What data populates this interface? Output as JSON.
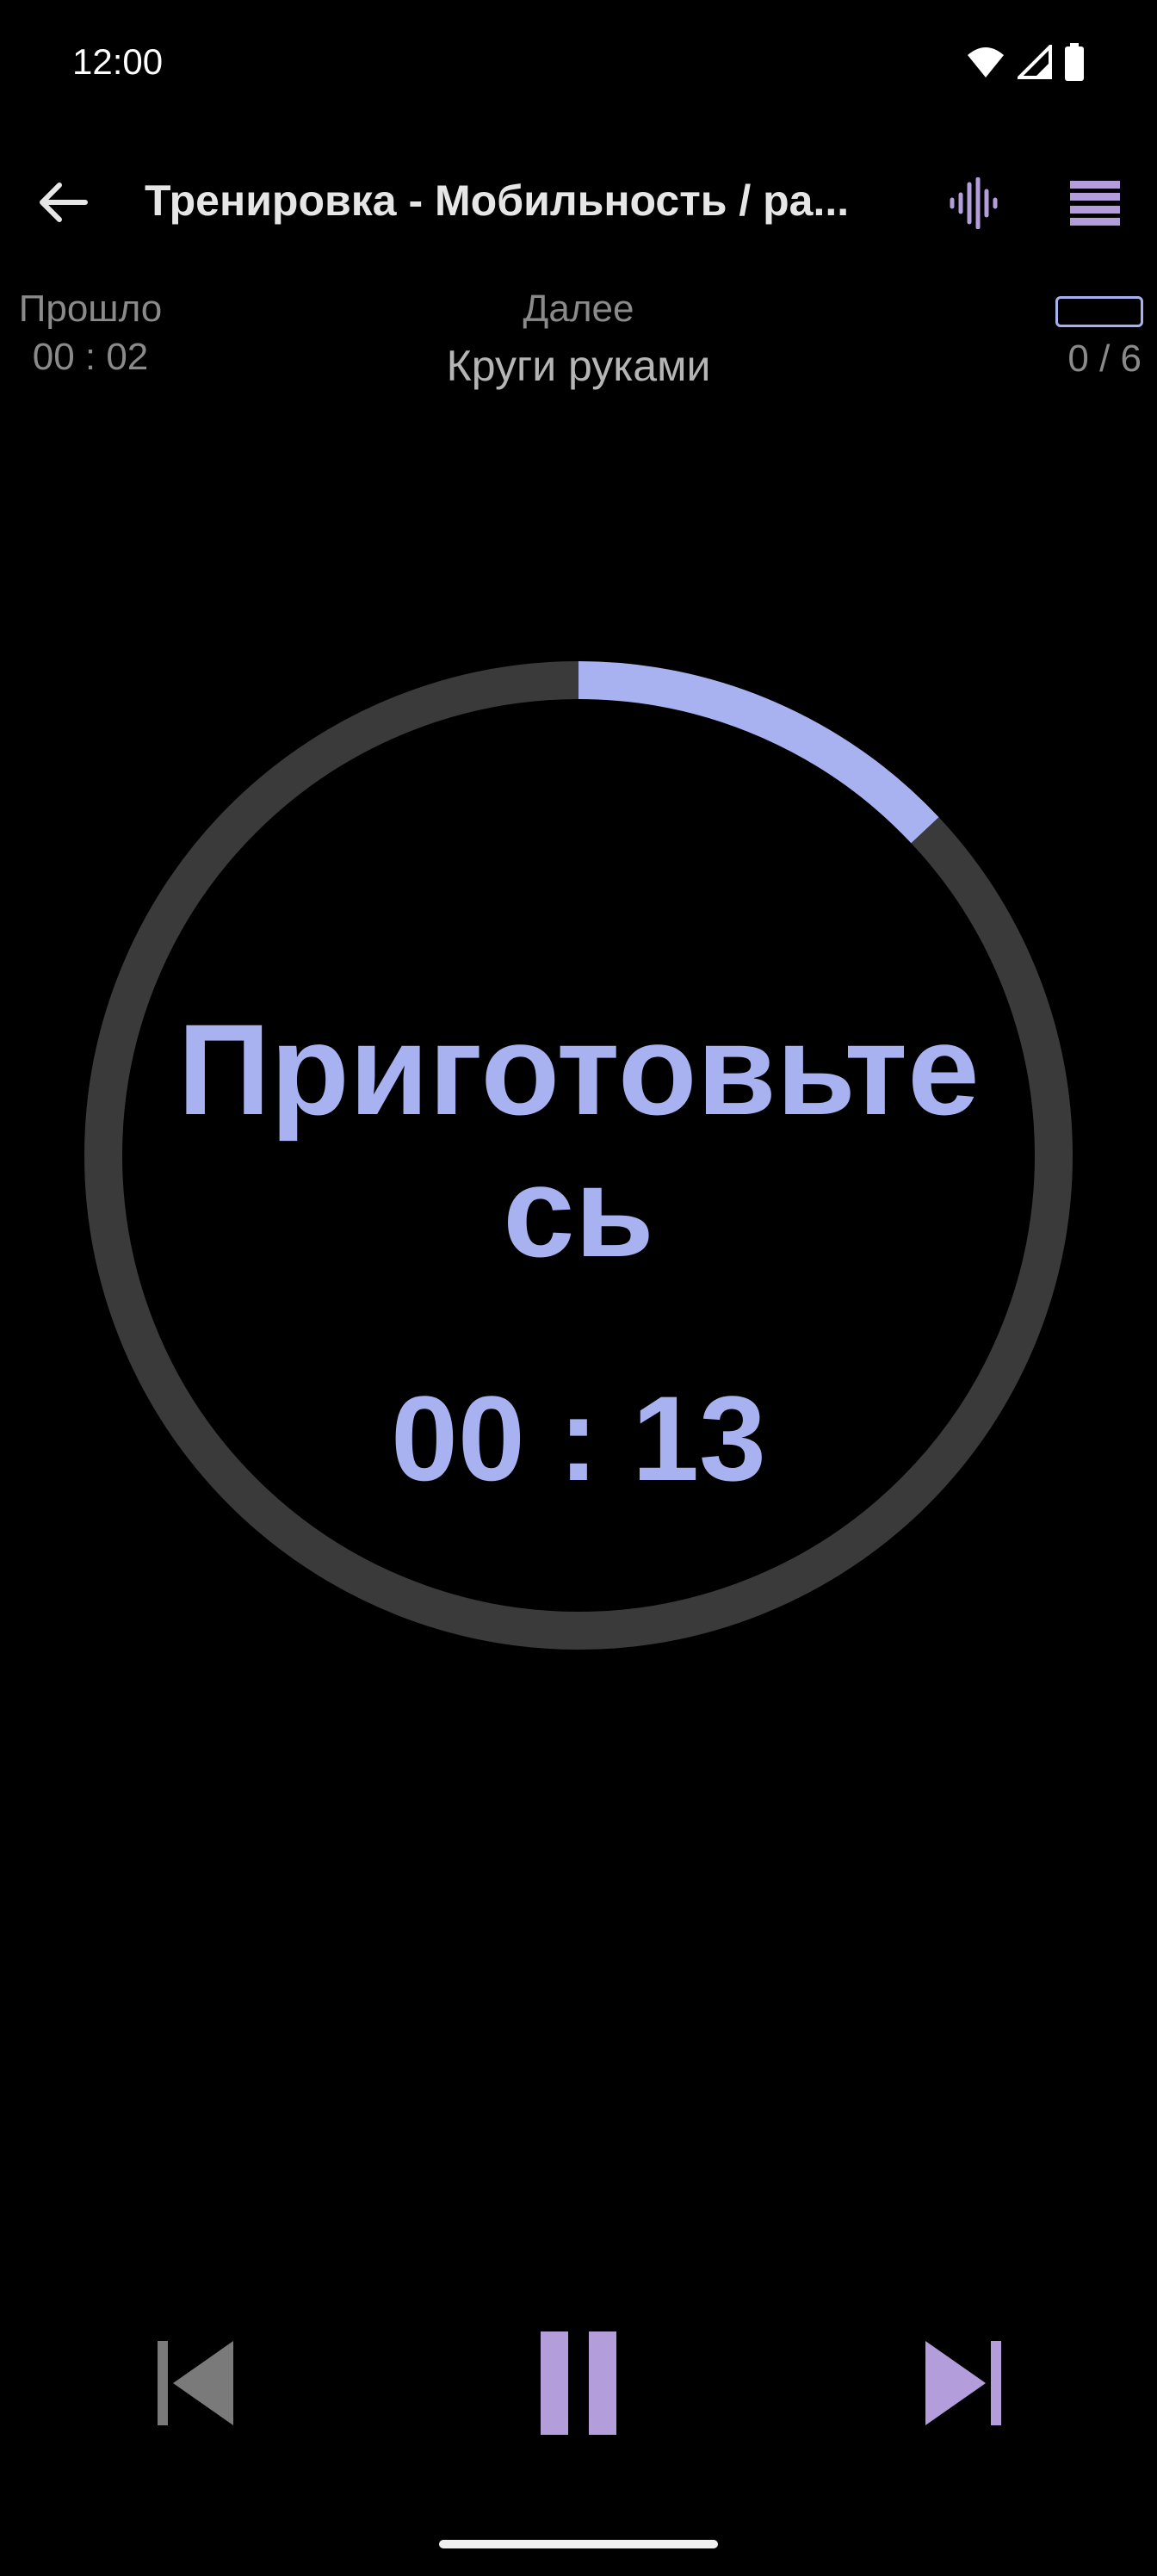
{
  "status_bar": {
    "time": "12:00",
    "icons": [
      "wifi-icon",
      "signal-icon",
      "battery-icon"
    ]
  },
  "app_bar": {
    "title": "Тренировка - Мобильность / ра...",
    "back_icon": "arrow-left-icon",
    "voice_icon": "sound-wave-icon",
    "menu_icon": "list-icon"
  },
  "info": {
    "elapsed_label": "Прошло",
    "elapsed_value": "00 : 02",
    "next_label": "Далее",
    "next_value": "Круги руками",
    "exercise_count": "0 / 6",
    "exercise_progress": 0
  },
  "timer": {
    "phase_text": "Приготовьтесь",
    "time": "00 : 13",
    "ring_progress": 0.13
  },
  "controls": {
    "previous_icon": "skip-previous-icon",
    "pause_icon": "pause-icon",
    "next_icon": "skip-next-icon"
  },
  "colors": {
    "accent": "#a8b2f0",
    "control_purple": "#b39ddb",
    "ring_track": "#3a3a3a",
    "muted_text": "#8a8a8a"
  }
}
